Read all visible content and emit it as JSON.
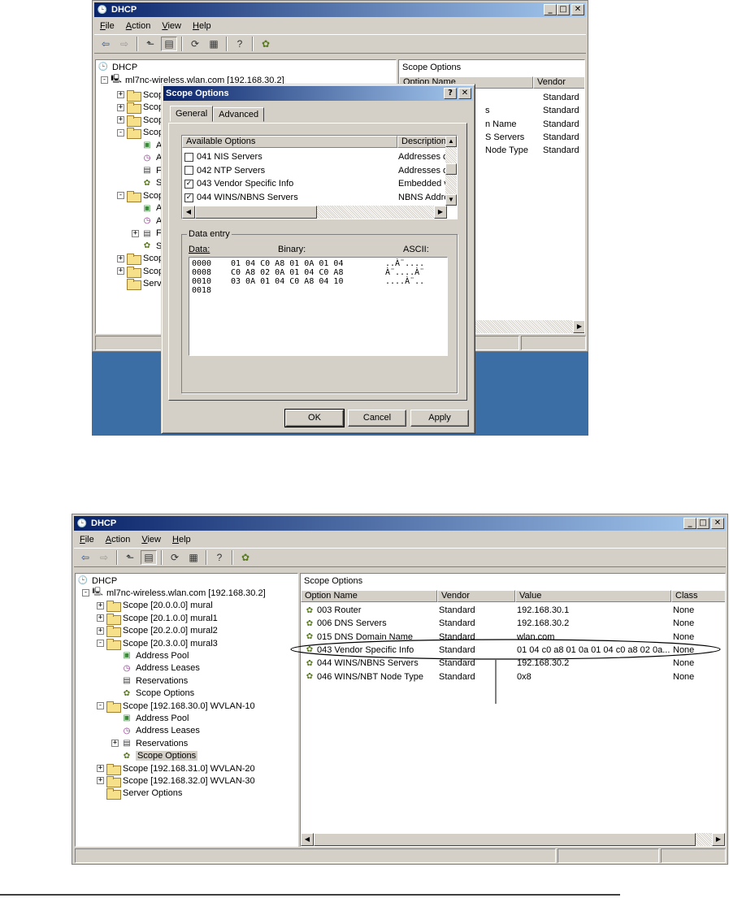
{
  "top_window": {
    "title": "DHCP",
    "menu": [
      {
        "key": "F",
        "rest": "ile"
      },
      {
        "key": "A",
        "rest": "ction"
      },
      {
        "key": "V",
        "rest": "iew"
      },
      {
        "key": "H",
        "rest": "elp"
      }
    ],
    "tree": {
      "root": "DHCP",
      "server": "ml7nc-wireless.wlan.com [192.168.30.2]",
      "items": [
        "Scop",
        "Scop",
        "Scop",
        "Scop",
        "A",
        "A",
        "F",
        "S",
        "Scop",
        "A",
        "A",
        "F",
        "S",
        "Scop",
        "Scop",
        "Serv"
      ]
    },
    "right_title": "Scope Options",
    "columns": [
      "Option Name",
      "Vendor"
    ],
    "rows": [
      {
        "name": "",
        "vendor": "Standard"
      },
      {
        "name": "s",
        "vendor": "Standard"
      },
      {
        "name": "n Name",
        "vendor": "Standard"
      },
      {
        "name": "S Servers",
        "vendor": "Standard"
      },
      {
        "name": "Node Type",
        "vendor": "Standard"
      }
    ]
  },
  "dialog": {
    "title": "Scope Options",
    "tabs": [
      "General",
      "Advanced"
    ],
    "list_headers": [
      "Available Options",
      "Description"
    ],
    "options": [
      {
        "name": "041 NIS Servers",
        "desc": "Addresses o",
        "checked": false
      },
      {
        "name": "042 NTP Servers",
        "desc": "Addresses o",
        "checked": false
      },
      {
        "name": "043 Vendor Specific Info",
        "desc": "Embedded v",
        "checked": true
      },
      {
        "name": "044 WINS/NBNS Servers",
        "desc": "NBNS Addre",
        "checked": true
      }
    ],
    "data_entry_label": "Data entry",
    "data_headers": [
      "Data:",
      "Binary:",
      "ASCII:"
    ],
    "hex_rows": [
      {
        "addr": "0000",
        "bytes": "01 04 C0 A8 01 0A 01 04",
        "ascii": "..À¨...."
      },
      {
        "addr": "0008",
        "bytes": "C0 A8 02 0A 01 04 C0 A8",
        "ascii": "À¨....À¨"
      },
      {
        "addr": "0010",
        "bytes": "03 0A 01 04 C0 A8 04 10",
        "ascii": "....À¨.."
      },
      {
        "addr": "0018",
        "bytes": "",
        "ascii": ""
      }
    ],
    "buttons": {
      "ok": "OK",
      "cancel": "Cancel",
      "apply": "Apply"
    }
  },
  "bottom_window": {
    "title": "DHCP",
    "menu": [
      {
        "key": "F",
        "rest": "ile"
      },
      {
        "key": "A",
        "rest": "ction"
      },
      {
        "key": "V",
        "rest": "iew"
      },
      {
        "key": "H",
        "rest": "elp"
      }
    ],
    "tree": [
      {
        "label": "DHCP",
        "level": 0,
        "icon": "dhcp",
        "exp": ""
      },
      {
        "label": "ml7nc-wireless.wlan.com [192.168.30.2]",
        "level": 1,
        "icon": "server",
        "exp": "-"
      },
      {
        "label": "Scope [20.0.0.0] mural",
        "level": 2,
        "icon": "folder",
        "exp": "+"
      },
      {
        "label": "Scope [20.1.0.0] mural1",
        "level": 2,
        "icon": "folder",
        "exp": "+"
      },
      {
        "label": "Scope [20.2.0.0] mural2",
        "level": 2,
        "icon": "folder",
        "exp": "+"
      },
      {
        "label": "Scope [20.3.0.0] mural3",
        "level": 2,
        "icon": "folder",
        "exp": "-"
      },
      {
        "label": "Address Pool",
        "level": 3,
        "icon": "pool",
        "exp": ""
      },
      {
        "label": "Address Leases",
        "level": 3,
        "icon": "leases",
        "exp": ""
      },
      {
        "label": "Reservations",
        "level": 3,
        "icon": "reserv",
        "exp": ""
      },
      {
        "label": "Scope Options",
        "level": 3,
        "icon": "options",
        "exp": ""
      },
      {
        "label": "Scope [192.168.30.0] WVLAN-10",
        "level": 2,
        "icon": "folder",
        "exp": "-"
      },
      {
        "label": "Address Pool",
        "level": 3,
        "icon": "pool",
        "exp": ""
      },
      {
        "label": "Address Leases",
        "level": 3,
        "icon": "leases",
        "exp": ""
      },
      {
        "label": "Reservations",
        "level": 3,
        "icon": "reserv",
        "exp": "+"
      },
      {
        "label": "Scope Options",
        "level": 3,
        "icon": "options",
        "exp": "",
        "selected": true
      },
      {
        "label": "Scope [192.168.31.0] WVLAN-20",
        "level": 2,
        "icon": "folder",
        "exp": "+"
      },
      {
        "label": "Scope [192.168.32.0] WVLAN-30",
        "level": 2,
        "icon": "folder",
        "exp": "+"
      },
      {
        "label": "Server Options",
        "level": 2,
        "icon": "folder",
        "exp": ""
      }
    ],
    "right_title": "Scope Options",
    "columns": [
      "Option Name",
      "Vendor",
      "Value",
      "Class"
    ],
    "rows": [
      {
        "name": "003 Router",
        "vendor": "Standard",
        "value": "192.168.30.1",
        "class": "None"
      },
      {
        "name": "006 DNS Servers",
        "vendor": "Standard",
        "value": "192.168.30.2",
        "class": "None"
      },
      {
        "name": "015 DNS Domain Name",
        "vendor": "Standard",
        "value": "wlan.com",
        "class": "None"
      },
      {
        "name": "043 Vendor Specific Info",
        "vendor": "Standard",
        "value": "01 04 c0 a8 01 0a 01 04 c0 a8 02 0a...",
        "class": "None"
      },
      {
        "name": "044 WINS/NBNS Servers",
        "vendor": "Standard",
        "value": "192.168.30.2",
        "class": "None"
      },
      {
        "name": "046 WINS/NBT Node Type",
        "vendor": "Standard",
        "value": "0x8",
        "class": "None"
      }
    ]
  },
  "colors": {
    "titlebar_start": "#0a246a",
    "titlebar_end": "#a6caf0",
    "desktop": "#3a6ea5",
    "face": "#d4d0c8"
  }
}
